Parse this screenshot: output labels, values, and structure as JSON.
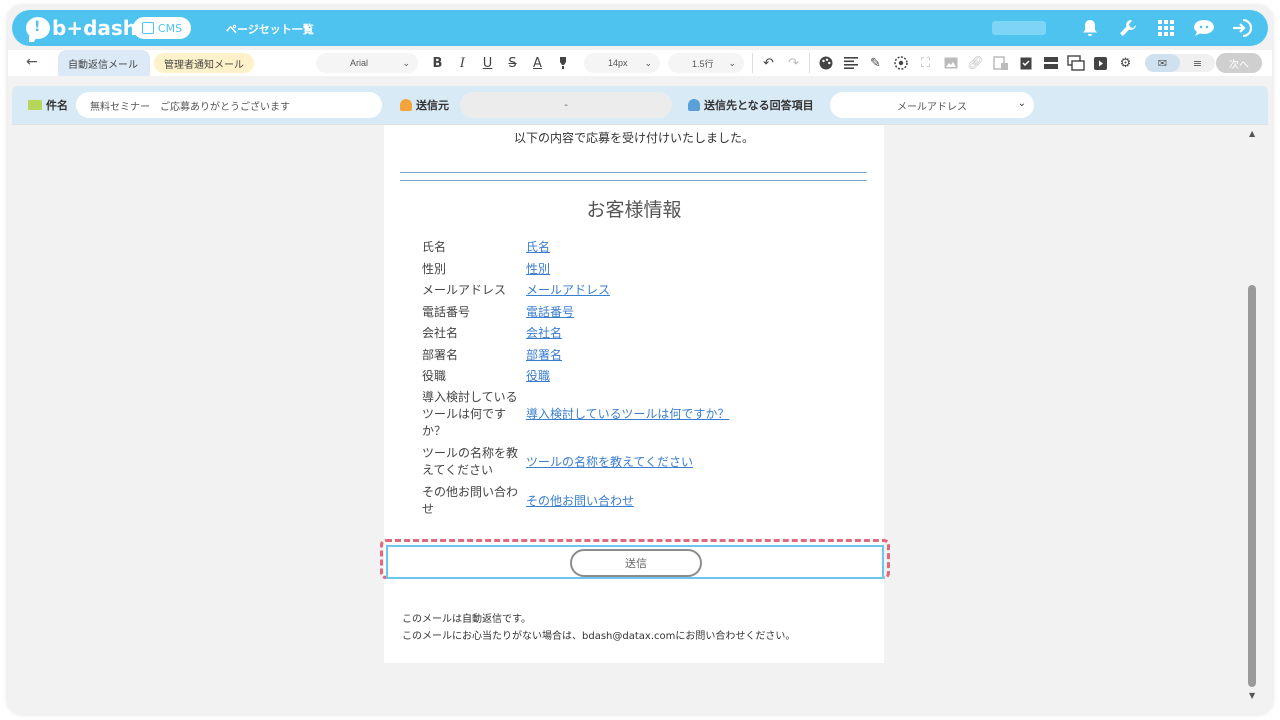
{
  "app": {
    "logo_text": "b+dash",
    "cms_label": "CMS",
    "page_title": "ページセット一覧"
  },
  "tabs": {
    "auto_reply": "自動返信メール",
    "admin_notify": "管理者通知メール"
  },
  "toolbar": {
    "font_family": "Arial",
    "font_size": "14px",
    "line_height": "1.5行",
    "next_label": "次へ"
  },
  "subject": {
    "subject_label": "件名",
    "subject_value": "無料セミナー　ご応募ありがとうございます",
    "sender_label": "送信元",
    "sender_value": "-",
    "recipient_label": "送信先となる回答項目",
    "recipient_value": "メールアドレス"
  },
  "mail": {
    "intro": "以下の内容で応募を受け付けいたしました。",
    "section_title": "お客様情報",
    "rows": [
      {
        "key": "氏名",
        "value": "氏名"
      },
      {
        "key": "性別",
        "value": "性別"
      },
      {
        "key": "メールアドレス",
        "value": "メールアドレス"
      },
      {
        "key": "電話番号",
        "value": "電話番号"
      },
      {
        "key": "会社名",
        "value": "会社名"
      },
      {
        "key": "部署名",
        "value": "部署名"
      },
      {
        "key": "役職",
        "value": "役職"
      },
      {
        "key": "導入検討しているツールは何ですか？",
        "value": "導入検討しているツールは何ですか？"
      },
      {
        "key": "ツールの名称を教えてください",
        "value": "ツールの名称を教えてください"
      },
      {
        "key": "その他お問い合わせ",
        "value": "その他お問い合わせ"
      }
    ],
    "send_label": "送信",
    "footer_line1": "このメールは自動返信です。",
    "footer_line2": "このメールにお心当たりがない場合は、bdash@datax.comにお問い合わせください。"
  }
}
